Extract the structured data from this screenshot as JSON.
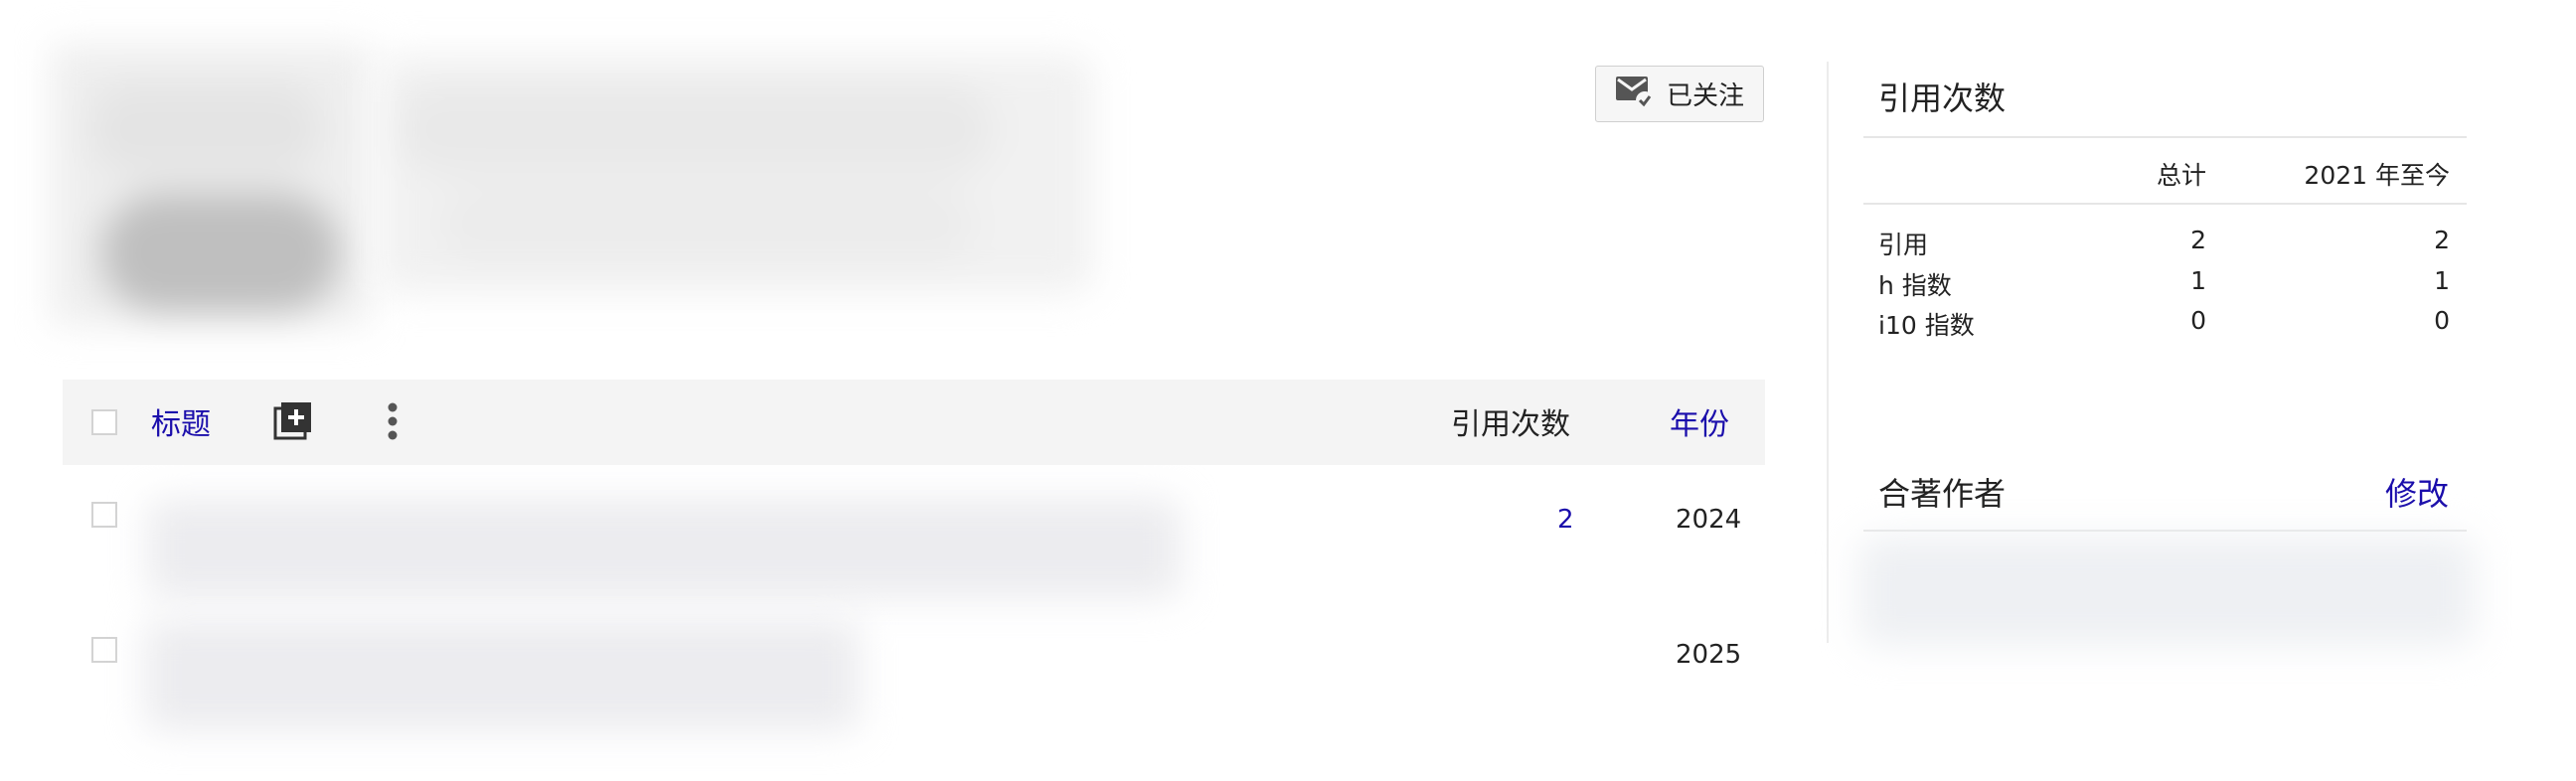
{
  "profile": {
    "follow_label": "已关注"
  },
  "articles": {
    "header": {
      "title_label": "标题",
      "cited_by_label": "引用次数",
      "year_label": "年份"
    },
    "rows": [
      {
        "cited_by": "2",
        "year": "2024"
      },
      {
        "cited_by": "",
        "year": "2025"
      }
    ]
  },
  "citations_panel": {
    "heading": "引用次数",
    "col_all": "总计",
    "col_since": "2021 年至今",
    "rows": [
      {
        "label": "引用",
        "all": "2",
        "since": "2"
      },
      {
        "label": "h 指数",
        "all": "1",
        "since": "1"
      },
      {
        "label": "i10 指数",
        "all": "0",
        "since": "0"
      }
    ]
  },
  "coauthors": {
    "heading": "合著作者",
    "edit_label": "修改"
  },
  "colors": {
    "link": "#1a0dab",
    "header_bg": "#f4f4f4"
  }
}
